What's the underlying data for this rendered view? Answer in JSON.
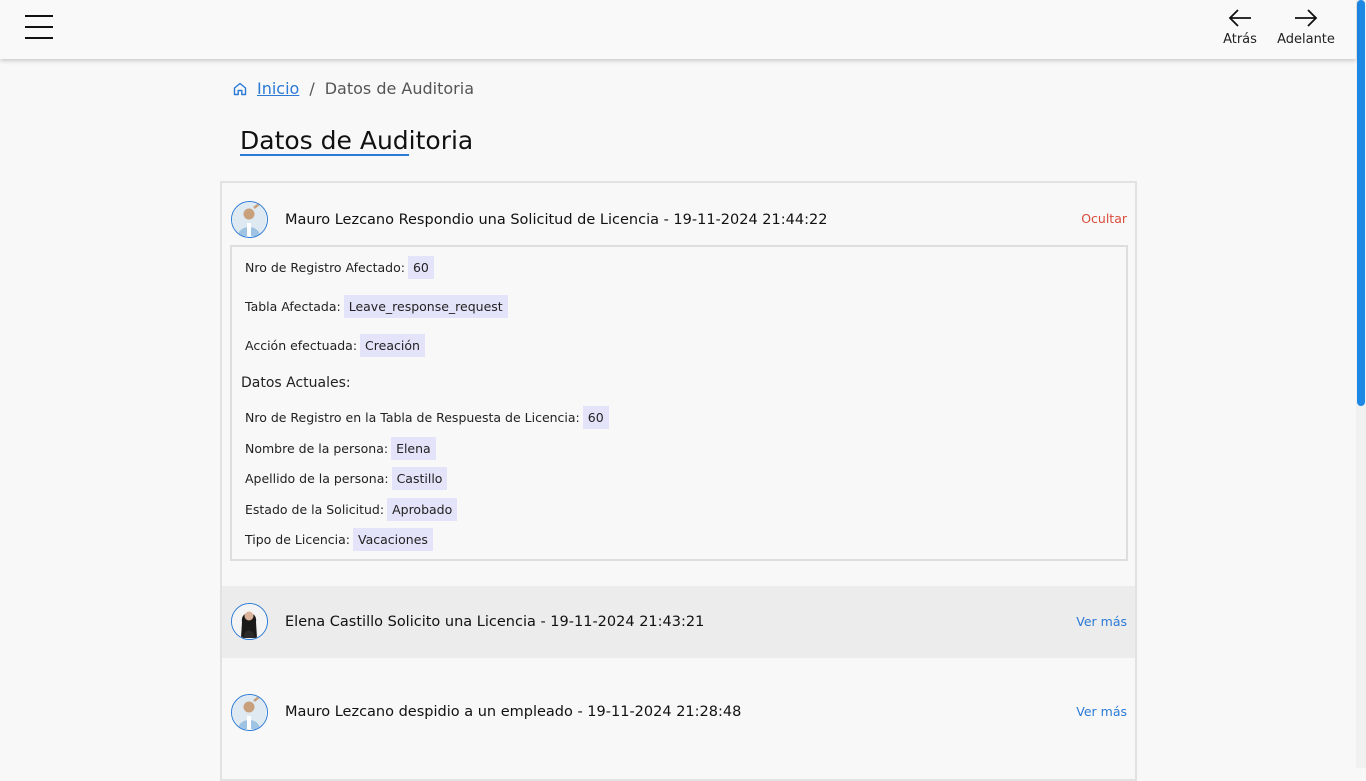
{
  "nav": {
    "back_label": "Atrás",
    "forward_label": "Adelante"
  },
  "breadcrumb": {
    "home": "Inicio",
    "separator": "/",
    "current": "Datos de Auditoria"
  },
  "page_title": "Datos de Auditoria",
  "colors": {
    "accent": "#2a7ad6",
    "danger": "#d94c3a",
    "tag_bg": "#e3e3fa"
  },
  "entries": [
    {
      "title": "Mauro Lezcano Respondio una Solicitud de Licencia - 19-11-2024 21:44:22",
      "action": "Ocultar",
      "avatar": "user-avatar-mauro",
      "details": {
        "registro_label": "Nro de Registro Afectado:",
        "registro_value": "60",
        "tabla_label": "Tabla Afectada:",
        "tabla_value": "Leave_response_request",
        "accion_label": "Acción efectuada:",
        "accion_value": "Creación",
        "section": "Datos Actuales:",
        "fields": [
          {
            "label": "Nro de Registro en la Tabla de Respuesta de Licencia:",
            "value": "60"
          },
          {
            "label": "Nombre de la persona:",
            "value": "Elena"
          },
          {
            "label": "Apellido de la persona:",
            "value": "Castillo"
          },
          {
            "label": "Estado de la Solicitud:",
            "value": "Aprobado"
          },
          {
            "label": "Tipo de Licencia:",
            "value": "Vacaciones"
          }
        ]
      }
    },
    {
      "title": "Elena Castillo Solicito una Licencia - 19-11-2024 21:43:21",
      "action": "Ver más",
      "avatar": "user-avatar-elena"
    },
    {
      "title": "Mauro Lezcano despidio a un empleado - 19-11-2024 21:28:48",
      "action": "Ver más",
      "avatar": "user-avatar-mauro"
    }
  ]
}
